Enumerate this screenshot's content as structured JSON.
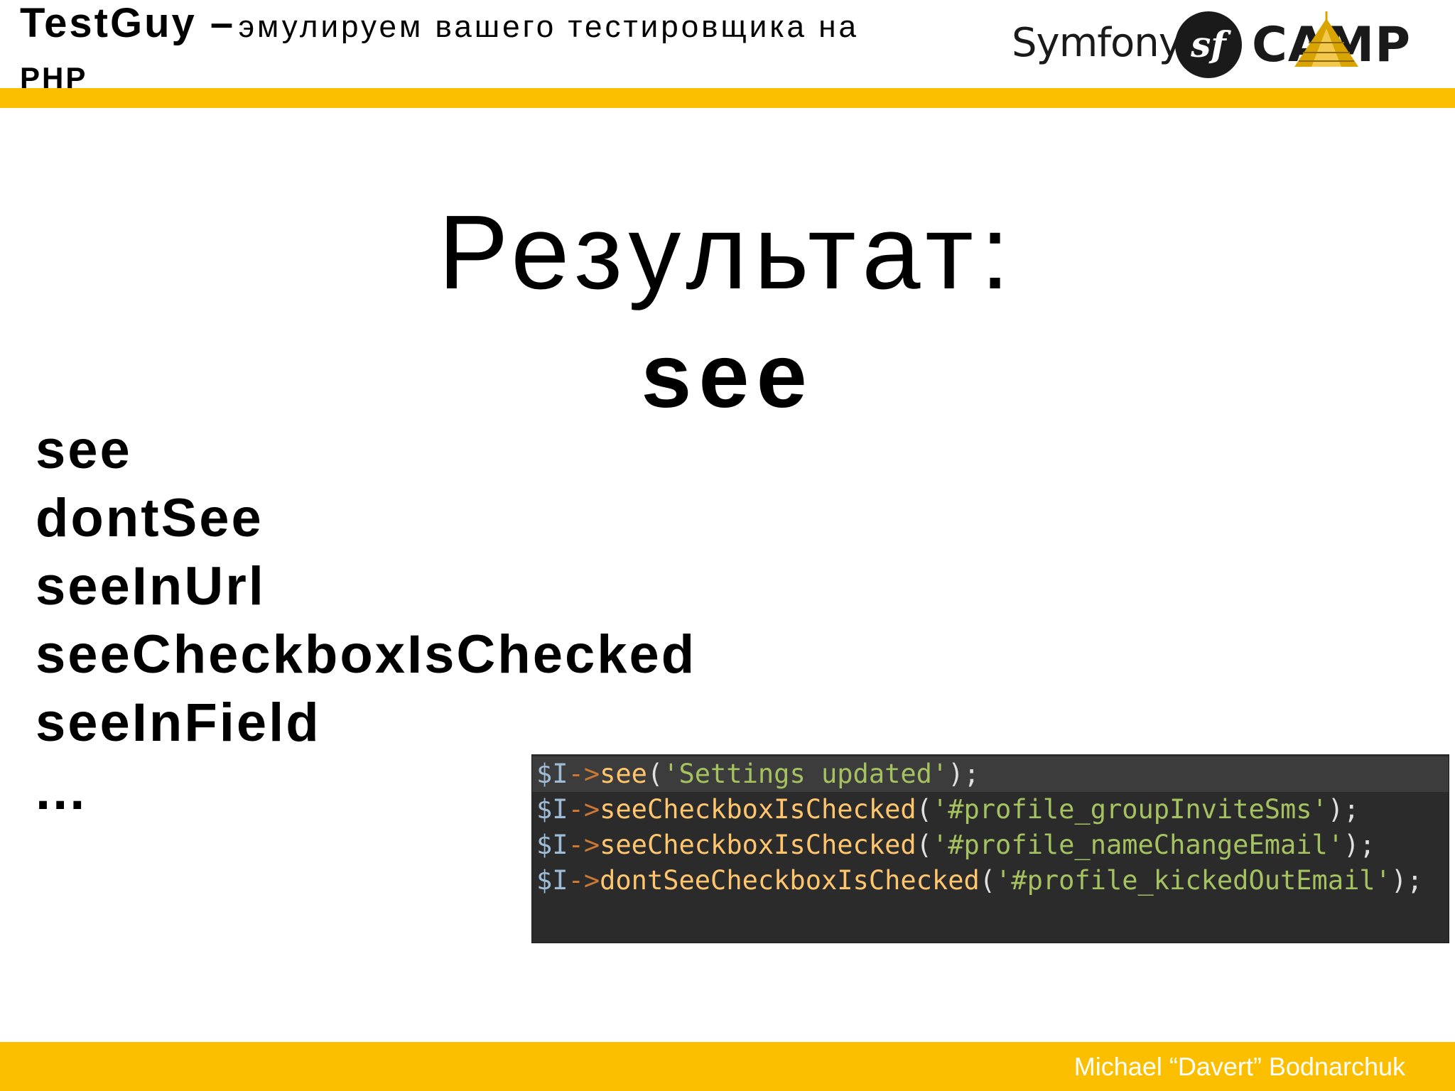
{
  "header": {
    "title_bold": "TestGuy –",
    "title_rest": "эмулируем вашего  тестировщика на",
    "title_end": "PHP",
    "logo": {
      "symfony_word": "Symfony",
      "badge_letters": "sf",
      "camp_c": "C",
      "camp_a": "A",
      "camp_mp": "MP",
      "icons": [
        "symfony-sf-badge-icon",
        "camp-tent-icon"
      ]
    }
  },
  "colors": {
    "accent": "#fbbf00",
    "code_bg": "#2b2b2b",
    "code_line_highlight": "#3c3c3c",
    "code_var": "#9fbcd6",
    "code_arrow": "#cc7832",
    "code_method": "#ffc66d",
    "code_string": "#a5c261"
  },
  "main": {
    "title": "Результат:",
    "subtitle": "see",
    "methods": [
      "see",
      "dontSee",
      "seeInUrl",
      "seeCheckboxIsChecked",
      "seeInField",
      "..."
    ]
  },
  "code": {
    "lines": [
      {
        "var": "$I",
        "arrow": "->",
        "method": "see",
        "open": "(",
        "arg": "'Settings updated'",
        "close": ");"
      },
      {
        "var": "$I",
        "arrow": "->",
        "method": "seeCheckboxIsChecked",
        "open": "(",
        "arg": "'#profile_groupInviteSms'",
        "close": ");"
      },
      {
        "var": "$I",
        "arrow": "->",
        "method": "seeCheckboxIsChecked",
        "open": "(",
        "arg": "'#profile_nameChangeEmail'",
        "close": ");"
      },
      {
        "var": "$I",
        "arrow": "->",
        "method": "dontSeeCheckboxIsChecked",
        "open": "(",
        "arg": "'#profile_kickedOutEmail'",
        "close": ");"
      }
    ]
  },
  "footer": {
    "author": "Michael “Davert” Bodnarchuk"
  }
}
